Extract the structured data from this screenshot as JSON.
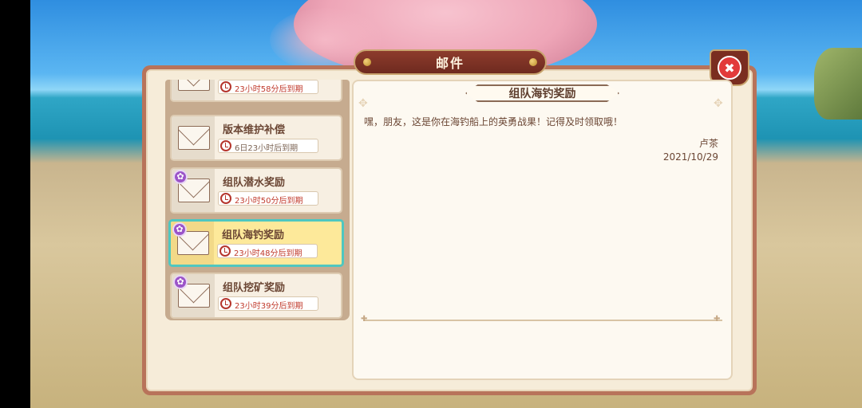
{
  "window": {
    "title": "邮件"
  },
  "mail_list": [
    {
      "title": "",
      "expire": "23小时58分后到期",
      "has_attachment": false,
      "expire_color": "#c0392b"
    },
    {
      "title": "版本维护补偿",
      "expire": "6日23小时后到期",
      "has_attachment": false,
      "expire_color": "#7d6555"
    },
    {
      "title": "组队潜水奖励",
      "expire": "23小时50分后到期",
      "has_attachment": true,
      "expire_color": "#c0392b"
    },
    {
      "title": "组队海钓奖励",
      "expire": "23小时48分后到期",
      "has_attachment": true,
      "expire_color": "#c0392b",
      "selected": true
    },
    {
      "title": "组队挖矿奖励",
      "expire": "23小时39分后到期",
      "has_attachment": true,
      "expire_color": "#c0392b"
    }
  ],
  "detail": {
    "subject": "组队海钓奖励",
    "body": "嘿，朋友，这是你在海钓船上的英勇战果！记得及时领取哦！",
    "sender": "卢茶",
    "date": "2021/10/29"
  },
  "icons": {
    "close": "close-icon",
    "envelope": "envelope-icon",
    "attachment": "gear-badge-icon",
    "expire": "clock-icon"
  },
  "colors": {
    "frame": "#b8735a",
    "banner": "#7a2d20",
    "selected_bg": "#fde99a",
    "selected_border": "#4fc7c0",
    "expire_red": "#c0392b"
  }
}
